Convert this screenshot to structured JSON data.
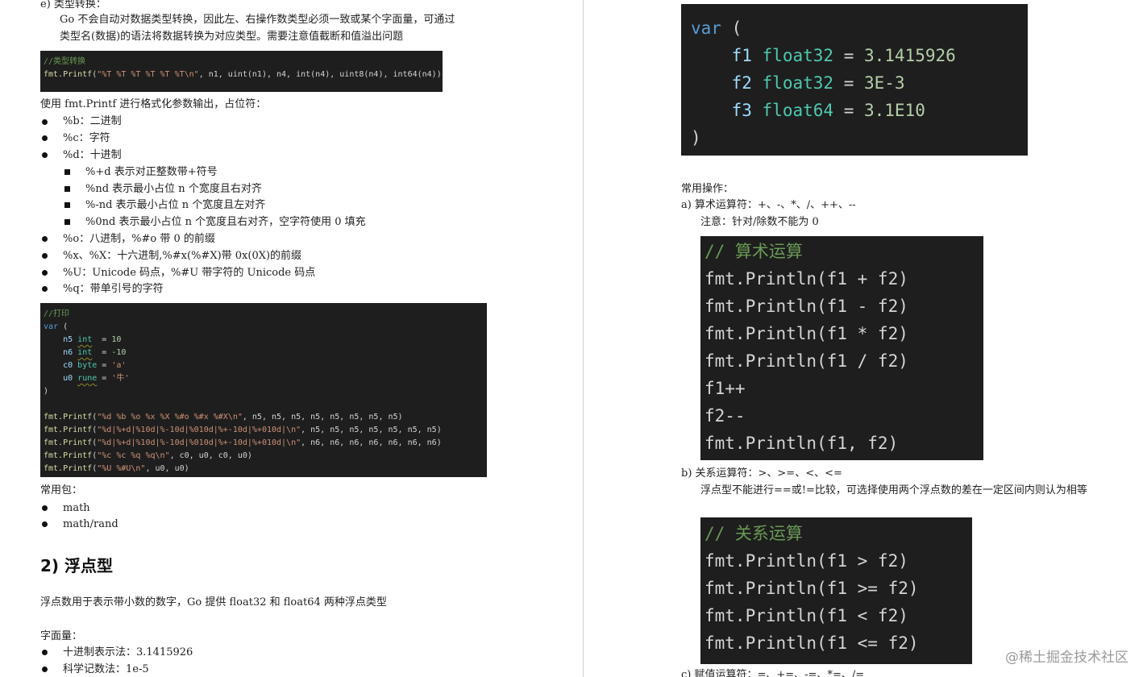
{
  "left": {
    "e_heading": "e)  类型转换：",
    "e_para_1": "Go 不会自动对数据类型转换，因此左、右操作数类型必须一致或某个字面量，可通过",
    "e_para_2": "类型名(数据)的语法将数据转换为对应类型。需要注意值截断和值溢出问题",
    "code_conv": {
      "comment": "//类型转换",
      "fn": "fmt.Printf",
      "open": "(",
      "str": "\"%T %T %T %T %T %T\\n\"",
      "args": ", n1, uint(n1), n4, int(n4), uint8(n4), int64(n4))"
    },
    "printf_intro": "使用 fmt.Printf 进行格式化参数输出，占位符：",
    "verbs": [
      "%b：二进制",
      "%c：字符",
      "%d：十进制",
      "%o：八进制，%#o 带 0 的前缀",
      "%x、%X：十六进制,%#x(%#X)带 0x(0X)的前缀",
      "%U：Unicode 码点，%#U 带字符的 Unicode 码点",
      "%q：带单引号的字符"
    ],
    "d_subs": [
      "%+d 表示对正整数带+符号",
      "%nd 表示最小占位 n 个宽度且右对齐",
      "%-nd 表示最小占位 n 个宽度且左对齐",
      "%0nd 表示最小占位 n 个宽度且右对齐，空字符使用 0 填充"
    ],
    "code_print": {
      "comment": "//打印",
      "var": "var",
      "open": " (",
      "vars": [
        {
          "name": "n5",
          "type": "int",
          "sep": "  = ",
          "val": "10",
          "cls": "nm"
        },
        {
          "name": "n6",
          "type": "int",
          "sep": "  = ",
          "val": "-10",
          "cls": "nm"
        },
        {
          "name": "c0",
          "type": "byte",
          "sep": " = ",
          "val": "'a'",
          "cls": "st"
        },
        {
          "name": "u0",
          "type": "rune",
          "sep": " = ",
          "val": "'牛'",
          "cls": "st"
        }
      ],
      "close": ")",
      "calls": [
        {
          "fn": "fmt.Printf",
          "str": "\"%d %b %o %x %X %#o %#x %#X\\n\"",
          "args": ", n5, n5, n5, n5, n5, n5, n5, n5)"
        },
        {
          "fn": "fmt.Printf",
          "str": "\"%d|%+d|%10d|%-10d|%010d|%+-10d|%+010d|\\n\"",
          "args": ", n5, n5, n5, n5, n5, n5, n5)"
        },
        {
          "fn": "fmt.Printf",
          "str": "\"%d|%+d|%10d|%-10d|%010d|%+-10d|%+010d|\\n\"",
          "args": ", n6, n6, n6, n6, n6, n6, n6)"
        },
        {
          "fn": "fmt.Printf",
          "str": "\"%c %c %q %q\\n\"",
          "args": ", c0, u0, c0, u0)"
        },
        {
          "fn": "fmt.Printf",
          "str": "\"%U %#U\\n\"",
          "args": ", u0, u0)"
        }
      ]
    },
    "packages_label": "常用包：",
    "packages": [
      "math",
      "math/rand"
    ],
    "section_title": "2) 浮点型",
    "float_desc": "浮点数用于表示带小数的数字，Go 提供 float32 和 float64 两种浮点类型",
    "literal_label": "字面量：",
    "literals": [
      "十进制表示法：3.1415926",
      "科学记数法：1e-5"
    ]
  },
  "right": {
    "code_var": {
      "kw": "var",
      "open": " (",
      "lines": [
        {
          "name": "f1",
          "type": "float32",
          "eq": " = ",
          "val": "3.1415926"
        },
        {
          "name": "f2",
          "type": "float32",
          "eq": " = ",
          "val": "3E-3"
        },
        {
          "name": "f3",
          "type": "float64",
          "eq": " = ",
          "val": "3.1E10"
        }
      ],
      "close": ")"
    },
    "ops_label": "常用操作：",
    "a_heading": "a)  算术运算符：+、-、*、/、++、--",
    "a_note": "注意：针对/除数不能为 0",
    "code_arith": [
      "// 算术运算",
      "fmt.Println(f1 + f2)",
      "fmt.Println(f1 - f2)",
      "fmt.Println(f1 * f2)",
      "fmt.Println(f1 / f2)",
      "f1++",
      "f2--",
      "fmt.Println(f1, f2)"
    ],
    "b_heading": "b)  关系运算符：>、>=、<、<=",
    "b_note": "浮点型不能进行==或!=比较，可选择使用两个浮点数的差在一定区间内则认为相等",
    "code_rel": [
      "// 关系运算",
      "fmt.Println(f1 > f2)",
      "fmt.Println(f1 >= f2)",
      "fmt.Println(f1 < f2)",
      "fmt.Println(f1 <= f2)"
    ],
    "c_heading": "c)  赋值运算符：=、+=、-=、*=、/="
  },
  "watermark": "@稀土掘金技术社区"
}
